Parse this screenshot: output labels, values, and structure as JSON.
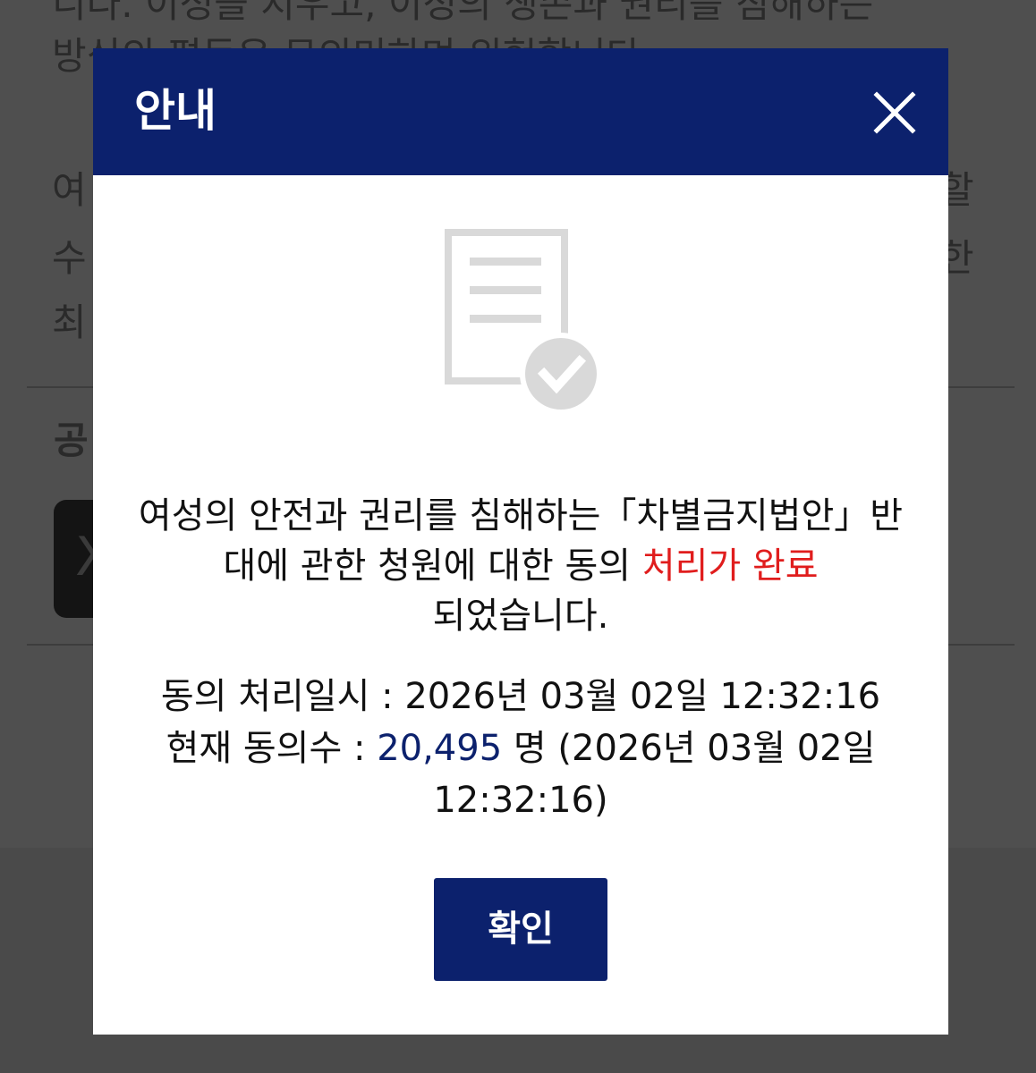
{
  "modal": {
    "title": "안내",
    "message": {
      "lead": "여성의 안전과 권리를 침해하는「차별금지법안」반대에 관한 청원에 대한 동의 ",
      "highlight": "처리가 완료",
      "tail": "되었습니다."
    },
    "details": {
      "processed_label": "동의 처리일시 : ",
      "processed_value": "2026년 03월 02일 12:32:16",
      "count_label": "현재 동의수 : ",
      "count_value": "20,495",
      "count_unit": " 명 ",
      "count_time": "(2026년 03월 02일 12:32:16)"
    },
    "confirm_label": "확인"
  },
  "icons": {
    "close": "close-icon",
    "document": "document-check-icon"
  },
  "colors": {
    "header": "#0c216d",
    "highlight": "#e01d1d",
    "count": "#0c216d",
    "overlay": "#4f4f4f"
  }
}
